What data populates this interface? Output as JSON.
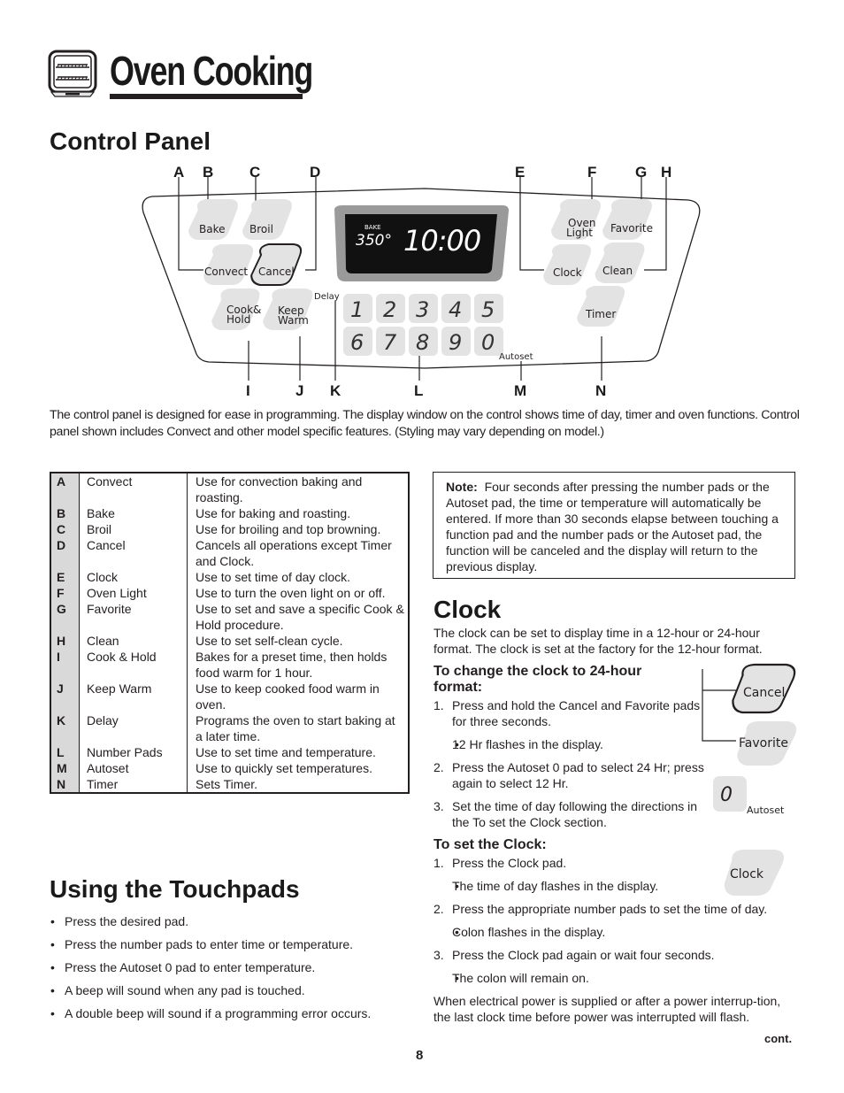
{
  "header": {
    "title": "Oven Cooking",
    "icon": "oven-icon"
  },
  "control_panel": {
    "heading": "Control Panel",
    "display": {
      "mode": "BAKE",
      "temperature": "350°",
      "time": "10:00"
    },
    "pads": {
      "bake": "Bake",
      "broil": "Broil",
      "convect": "Convect",
      "cancel": "Cancel",
      "cook_hold_1": "Cook&",
      "cook_hold_2": "Hold",
      "keep_warm_1": "Keep",
      "keep_warm_2": "Warm",
      "delay": "Delay",
      "oven_light_1": "Oven",
      "oven_light_2": "Light",
      "favorite": "Favorite",
      "clock": "Clock",
      "clean": "Clean",
      "timer": "Timer",
      "autoset": "Autoset"
    },
    "number_pads": [
      "1",
      "2",
      "3",
      "4",
      "5",
      "6",
      "7",
      "8",
      "9",
      "0"
    ],
    "callouts_top": [
      "A",
      "B",
      "C",
      "D",
      "E",
      "F",
      "G",
      "H"
    ],
    "callouts_bottom": [
      "I",
      "J",
      "K",
      "L",
      "M",
      "N"
    ],
    "intro": "The control panel is designed for ease in programming. The display window on the control shows time of day, timer and oven functions. Control panel shown includes Convect and other model specific features. (Styling may vary depending on model.)"
  },
  "feature_table": {
    "rows": [
      {
        "letter": "A",
        "name": "Convect",
        "desc": "Use for convection baking and roasting."
      },
      {
        "letter": "B",
        "name": "Bake",
        "desc": "Use for baking and roasting."
      },
      {
        "letter": "C",
        "name": "Broil",
        "desc": "Use for broiling and top browning."
      },
      {
        "letter": "D",
        "name": "Cancel",
        "desc": "Cancels all operations except Timer and Clock."
      },
      {
        "letter": "E",
        "name": "Clock",
        "desc": "Use to set time of day clock."
      },
      {
        "letter": "F",
        "name": "Oven Light",
        "desc": "Use to turn the oven light on or off."
      },
      {
        "letter": "G",
        "name": "Favorite",
        "desc": "Use to set and save a specific Cook & Hold procedure."
      },
      {
        "letter": "H",
        "name": "Clean",
        "desc": "Use to set self-clean cycle."
      },
      {
        "letter": "I",
        "name": "Cook & Hold",
        "desc": "Bakes for a preset time, then holds food warm for 1 hour."
      },
      {
        "letter": "J",
        "name": "Keep Warm",
        "desc": "Use to keep cooked food warm in oven."
      },
      {
        "letter": "K",
        "name": "Delay",
        "desc": "Programs the oven to start baking at a later time."
      },
      {
        "letter": "L",
        "name": "Number Pads",
        "desc": "Use to set time and temperature."
      },
      {
        "letter": "M",
        "name": "Autoset",
        "desc": "Use to quickly set temperatures."
      },
      {
        "letter": "N",
        "name": "Timer",
        "desc": "Sets Timer."
      }
    ]
  },
  "note": {
    "label": "Note:",
    "text": "Four seconds after pressing the number pads or the Autoset pad, the time or temperature will automatically be entered.  If more than 30 seconds elapse between touching a function pad and the number pads or the Autoset pad, the function will be canceled and the display will return to the previous display."
  },
  "clock": {
    "heading": "Clock",
    "intro": "The clock can be set to display time in a 12-hour or 24-hour format.  The clock is set at the factory for the 12-hour format.",
    "format_heading": "To change the clock to 24-hour format:",
    "format_steps": [
      {
        "num": "1.",
        "text": "Press and hold the Cancel and Favorite pads for three seconds.",
        "sub": "12 Hr flashes in the display."
      },
      {
        "num": "2.",
        "text": "Press the Autoset 0 pad to select 24 Hr; press again to select 12 Hr.",
        "sub": null
      },
      {
        "num": "3.",
        "text": "Set the time of day following the directions in the To set the Clock section.",
        "sub": null
      }
    ],
    "set_heading": "To set the Clock:",
    "set_steps": [
      {
        "num": "1.",
        "text": "Press the Clock pad.",
        "sub": "The time of day flashes in the display."
      },
      {
        "num": "2.",
        "text": "Press the appropriate number pads to set the time of day.",
        "sub": "Colon flashes in the display."
      },
      {
        "num": "3.",
        "text": "Press the Clock pad again or wait four seconds.",
        "sub": "The colon will remain on."
      }
    ],
    "power_text": "When electrical power is supplied or after a power interrup-tion, the last clock time before power was interrupted will flash.",
    "side_pads": {
      "cancel": "Cancel",
      "favorite": "Favorite",
      "zero": "0",
      "autoset": "Autoset",
      "clock": "Clock"
    },
    "cont": "cont."
  },
  "touchpads": {
    "heading": "Using the Touchpads",
    "items": [
      "Press the desired pad.",
      "Press the number pads to enter time or temperature.",
      "Press the Autoset 0 pad to enter temperature.",
      "A beep will sound when any pad is touched.",
      "A double beep will sound if a programming error occurs."
    ]
  },
  "page_number": "8"
}
